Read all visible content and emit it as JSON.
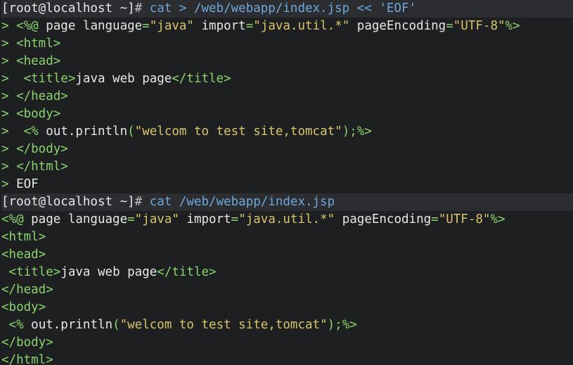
{
  "terminal": {
    "lines": [
      {
        "kind": "cmd",
        "segments": [
          {
            "t": "[root@localhost ~]",
            "c": "prompt"
          },
          {
            "t": "# ",
            "c": "hash"
          },
          {
            "t": "cat > /web/webapp/index.jsp << 'EOF'",
            "c": "cmd"
          }
        ]
      },
      {
        "kind": "out",
        "segments": [
          {
            "t": "> ",
            "c": "cont"
          },
          {
            "t": "<%@",
            "c": "tag"
          },
          {
            "t": " page language",
            "c": "attr"
          },
          {
            "t": "=",
            "c": "eq"
          },
          {
            "t": "\"java\"",
            "c": "str"
          },
          {
            "t": " import",
            "c": "attr"
          },
          {
            "t": "=",
            "c": "eq"
          },
          {
            "t": "\"java.util.*\"",
            "c": "str"
          },
          {
            "t": " pageEncoding",
            "c": "attr"
          },
          {
            "t": "=",
            "c": "eq"
          },
          {
            "t": "\"UTF-8\"",
            "c": "str"
          },
          {
            "t": "%>",
            "c": "tag"
          }
        ]
      },
      {
        "kind": "out",
        "segments": [
          {
            "t": "> ",
            "c": "cont"
          },
          {
            "t": "<html>",
            "c": "tag"
          }
        ]
      },
      {
        "kind": "out",
        "segments": [
          {
            "t": "> ",
            "c": "cont"
          },
          {
            "t": "<head>",
            "c": "tag"
          }
        ]
      },
      {
        "kind": "out",
        "segments": [
          {
            "t": ">  ",
            "c": "cont"
          },
          {
            "t": "<title>",
            "c": "tag"
          },
          {
            "t": "java web page",
            "c": "plain"
          },
          {
            "t": "</title>",
            "c": "tag"
          }
        ]
      },
      {
        "kind": "out",
        "segments": [
          {
            "t": "> ",
            "c": "cont"
          },
          {
            "t": "</head>",
            "c": "tag"
          }
        ]
      },
      {
        "kind": "out",
        "segments": [
          {
            "t": "> ",
            "c": "cont"
          },
          {
            "t": "<body>",
            "c": "tag"
          }
        ]
      },
      {
        "kind": "out",
        "segments": [
          {
            "t": ">  ",
            "c": "cont"
          },
          {
            "t": "<%",
            "c": "tag"
          },
          {
            "t": " out.println",
            "c": "plain"
          },
          {
            "t": "(",
            "c": "eq"
          },
          {
            "t": "\"welcom to test site,tomcat\"",
            "c": "str"
          },
          {
            "t": ");",
            "c": "eq"
          },
          {
            "t": "%>",
            "c": "tag"
          }
        ]
      },
      {
        "kind": "out",
        "segments": [
          {
            "t": "> ",
            "c": "cont"
          },
          {
            "t": "</body>",
            "c": "tag"
          }
        ]
      },
      {
        "kind": "out",
        "segments": [
          {
            "t": "> ",
            "c": "cont"
          },
          {
            "t": "</html>",
            "c": "tag"
          }
        ]
      },
      {
        "kind": "out",
        "segments": [
          {
            "t": "> ",
            "c": "cont"
          },
          {
            "t": "EOF",
            "c": "plain"
          }
        ]
      },
      {
        "kind": "cmd",
        "segments": [
          {
            "t": "[root@localhost ~]",
            "c": "prompt"
          },
          {
            "t": "# ",
            "c": "hash"
          },
          {
            "t": "cat /web/webapp/index.jsp",
            "c": "cmd"
          }
        ]
      },
      {
        "kind": "out",
        "segments": [
          {
            "t": "<%@",
            "c": "tag"
          },
          {
            "t": " page language",
            "c": "attr"
          },
          {
            "t": "=",
            "c": "eq"
          },
          {
            "t": "\"java\"",
            "c": "str"
          },
          {
            "t": " import",
            "c": "attr"
          },
          {
            "t": "=",
            "c": "eq"
          },
          {
            "t": "\"java.util.*\"",
            "c": "str"
          },
          {
            "t": " pageEncoding",
            "c": "attr"
          },
          {
            "t": "=",
            "c": "eq"
          },
          {
            "t": "\"UTF-8\"",
            "c": "str"
          },
          {
            "t": "%>",
            "c": "tag"
          }
        ]
      },
      {
        "kind": "out",
        "segments": [
          {
            "t": "<html>",
            "c": "tag"
          }
        ]
      },
      {
        "kind": "out",
        "segments": [
          {
            "t": "<head>",
            "c": "tag"
          }
        ]
      },
      {
        "kind": "out",
        "segments": [
          {
            "t": " ",
            "c": "plain"
          },
          {
            "t": "<title>",
            "c": "tag"
          },
          {
            "t": "java web page",
            "c": "plain"
          },
          {
            "t": "</title>",
            "c": "tag"
          }
        ]
      },
      {
        "kind": "out",
        "segments": [
          {
            "t": "</head>",
            "c": "tag"
          }
        ]
      },
      {
        "kind": "out",
        "segments": [
          {
            "t": "<body>",
            "c": "tag"
          }
        ]
      },
      {
        "kind": "out",
        "segments": [
          {
            "t": " ",
            "c": "plain"
          },
          {
            "t": "<%",
            "c": "tag"
          },
          {
            "t": " out.println",
            "c": "plain"
          },
          {
            "t": "(",
            "c": "eq"
          },
          {
            "t": "\"welcom to test site,tomcat\"",
            "c": "str"
          },
          {
            "t": ");",
            "c": "eq"
          },
          {
            "t": "%>",
            "c": "tag"
          }
        ]
      },
      {
        "kind": "out",
        "segments": [
          {
            "t": "</body>",
            "c": "tag"
          }
        ]
      },
      {
        "kind": "out",
        "segments": [
          {
            "t": "</html>",
            "c": "tag"
          }
        ]
      }
    ]
  }
}
